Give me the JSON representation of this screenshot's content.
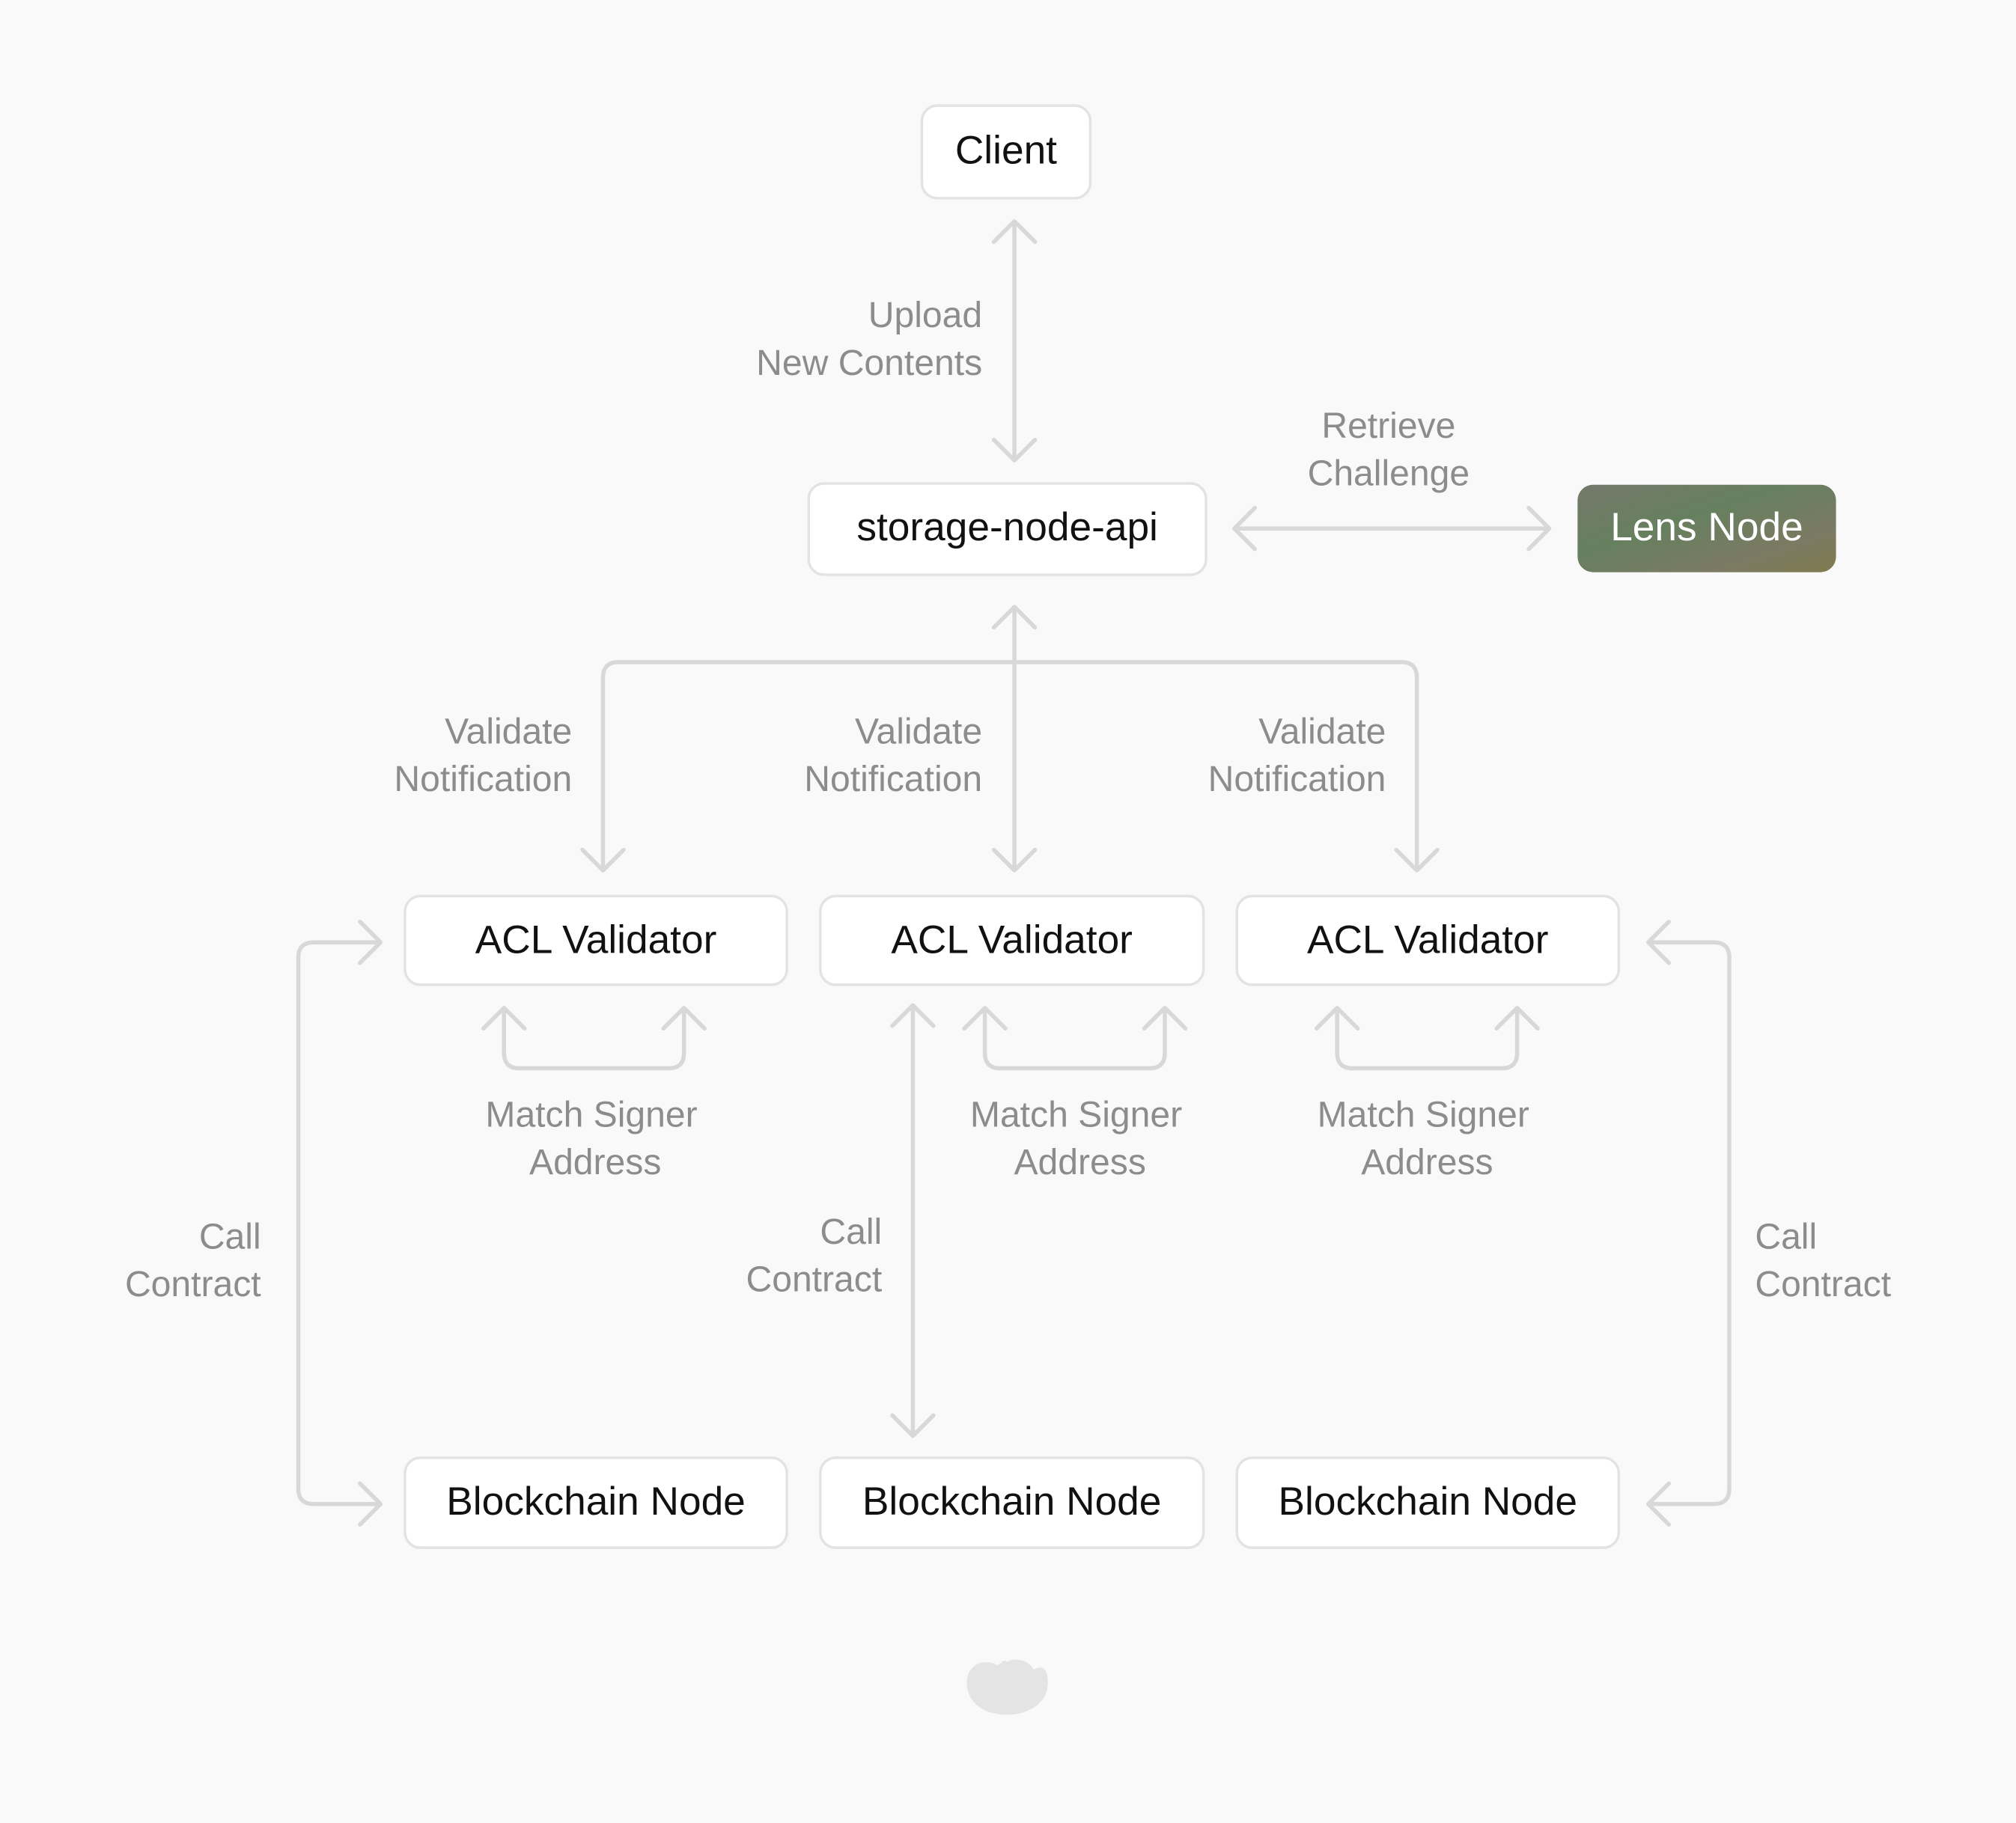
{
  "nodes": {
    "client": "Client",
    "storage": "storage-node-api",
    "lens": "Lens Node",
    "acl": [
      "ACL Validator",
      "ACL Validator",
      "ACL Validator"
    ],
    "blockchain": [
      "Blockchain Node",
      "Blockchain Node",
      "Blockchain Node"
    ]
  },
  "labels": {
    "upload": [
      "Upload",
      "New Contents"
    ],
    "retrieve": [
      "Retrieve",
      "Challenge"
    ],
    "validate": [
      [
        "Validate",
        "Notification"
      ],
      [
        "Validate",
        "Notification"
      ],
      [
        "Validate",
        "Notification"
      ]
    ],
    "match": [
      [
        "Match Signer",
        "Address"
      ],
      [
        "Match Signer",
        "Address"
      ],
      [
        "Match Signer",
        "Address"
      ]
    ],
    "call": [
      [
        "Call",
        "Contract"
      ],
      [
        "Call",
        "Contract"
      ],
      [
        "Call",
        "Contract"
      ]
    ]
  },
  "colors": {
    "background": "#f9f9f9",
    "arrow": "#d8d8d8",
    "label": "#8c8c8c",
    "lens_gradient": [
      "#6f7a6c",
      "#66805f",
      "#7e7a52"
    ]
  },
  "logo": "cloud-icon"
}
